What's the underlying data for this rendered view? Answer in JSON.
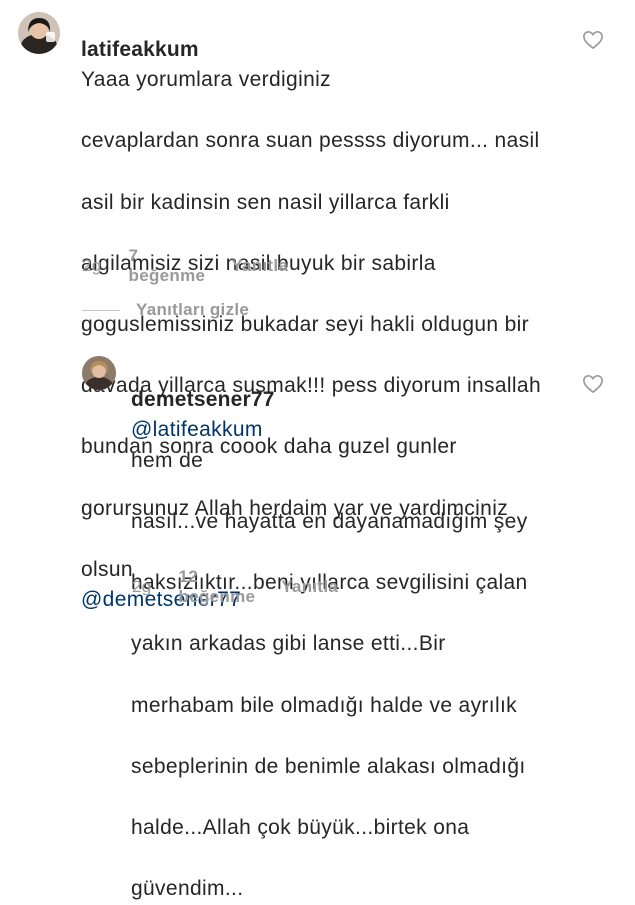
{
  "comment1": {
    "username": "latifeakkum",
    "text_lines": [
      "Yaaa yorumlara verdiginiz",
      "cevaplardan sonra suan pessss diyorum... nasil",
      "asil bir kadinsin sen nasil yillarca farkli",
      "algilamisiz sizi nasil buyuk bir sabirla",
      "goguslemissiniz bukadar seyi hakli oldugun bir",
      "davada yillarca susmak!!! pess diyorum insallah",
      "bundan sonra coook daha guzel gunler",
      "gorursunuz Allah herdaim yar ve yardimciniz",
      "olsun"
    ],
    "mention": "@demetsener77",
    "time": "2g",
    "likes": "7 beğenme",
    "reply": "Yanıtla",
    "avatar_icon": "profile-photo"
  },
  "replies_toggle": {
    "label": "Yanıtları gizle"
  },
  "comment2": {
    "username": "demetsener77",
    "mention": "@latifeakkum",
    "text_lines": [
      "hem de",
      "nasıl...ve hayatta en dayanamadığım şey",
      "haksızlıktır...beni yıllarca sevgilisini çalan",
      "yakın arkadas gibi lanse etti...Bir",
      "merhabam bile olmadığı halde ve ayrılık",
      "sebeplerinin de benimle alakası olmadığı",
      "halde...Allah çok büyük...birtek ona",
      "güvendim..."
    ],
    "time": "2g",
    "likes": "12 beğenme",
    "reply": "Yanıtla",
    "avatar_icon": "profile-photo"
  },
  "icons": {
    "like": "heart-outline-icon"
  },
  "colors": {
    "text": "#262626",
    "muted": "#999999",
    "mention": "#003569",
    "divider": "#c7c7c7"
  }
}
